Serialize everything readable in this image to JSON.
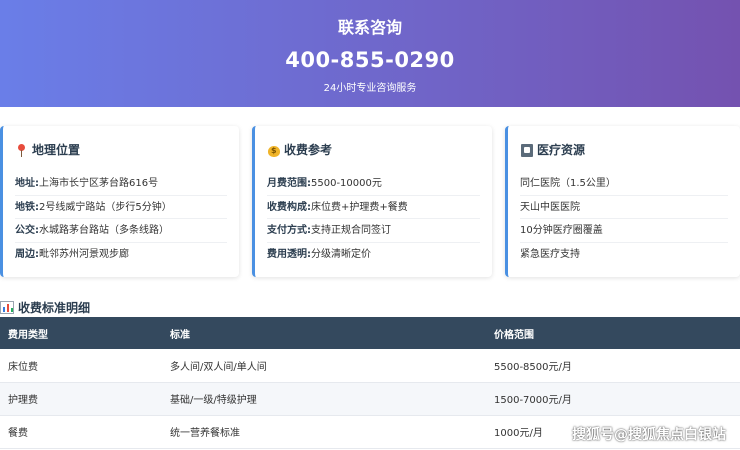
{
  "hero": {
    "title": "联系咨询",
    "phone": "400-855-0290",
    "subtitle": "24小时专业咨询服务"
  },
  "cards": [
    {
      "icon": "pin-icon",
      "title": "地理位置",
      "rows": [
        {
          "label": "地址:",
          "value": "上海市长宁区茅台路616号"
        },
        {
          "label": "地铁:",
          "value": "2号线威宁路站（步行5分钟）"
        },
        {
          "label": "公交:",
          "value": "水城路茅台路站（多条线路）"
        },
        {
          "label": "周边:",
          "value": "毗邻苏州河景观步廊"
        }
      ]
    },
    {
      "icon": "money-bag-icon",
      "title": "收费参考",
      "rows": [
        {
          "label": "月费范围:",
          "value": "5500-10000元"
        },
        {
          "label": "收费构成:",
          "value": "床位费+护理费+餐费"
        },
        {
          "label": "支付方式:",
          "value": "支持正规合同签订"
        },
        {
          "label": "费用透明:",
          "value": "分级清晰定价"
        }
      ]
    },
    {
      "icon": "hospital-icon",
      "title": "医疗资源",
      "rows": [
        {
          "label": "",
          "value": "同仁医院（1.5公里）"
        },
        {
          "label": "",
          "value": "天山中医医院"
        },
        {
          "label": "",
          "value": "10分钟医疗圈覆盖"
        },
        {
          "label": "",
          "value": "紧急医疗支持"
        }
      ]
    }
  ],
  "fee_section": {
    "title": "收费标准明细",
    "icon": "bar-chart-icon",
    "headers": [
      "费用类型",
      "标准",
      "价格范围"
    ],
    "rows": [
      [
        "床位费",
        "多人间/双人间/单人间",
        "5500-8500元/月"
      ],
      [
        "护理费",
        "基础/一级/特级护理",
        "1500-7000元/月"
      ],
      [
        "餐费",
        "统一营养餐标准",
        "1000元/月"
      ]
    ]
  },
  "watermark": "搜狐号@搜狐焦点白银站",
  "colors": {
    "hero_gradient_start": "#6a7ee8",
    "hero_gradient_end": "#7452b0",
    "card_accent": "#4a90e2",
    "table_header": "#34495e"
  }
}
